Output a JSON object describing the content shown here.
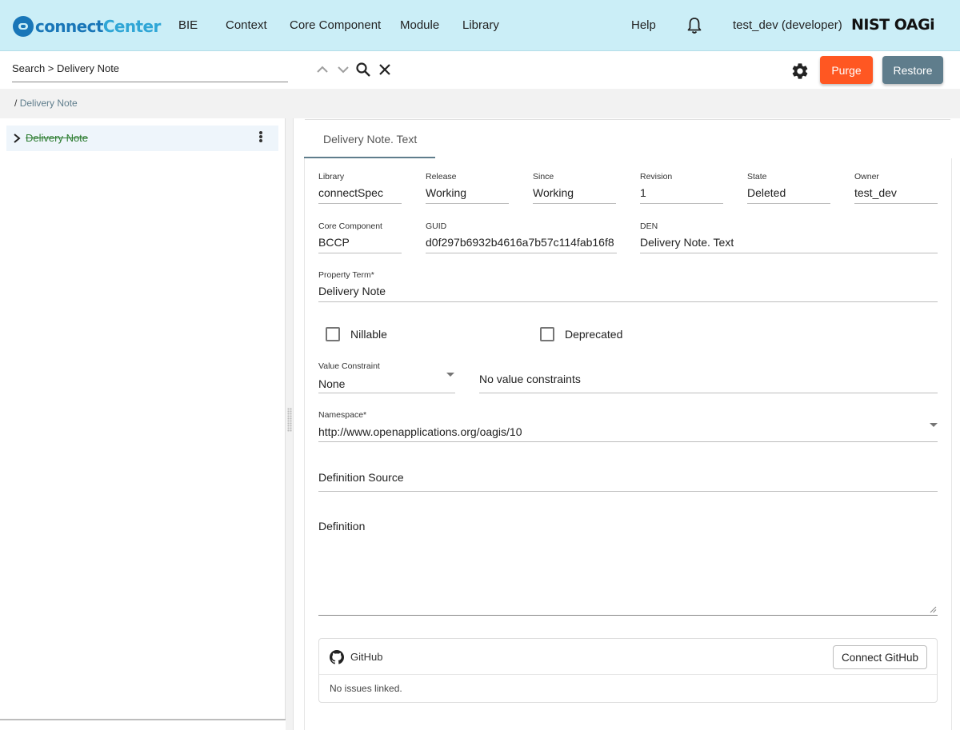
{
  "brand": {
    "part1": "connect",
    "part2": "Center"
  },
  "nav": {
    "items": [
      "BIE",
      "Context",
      "Core Component",
      "Module",
      "Library"
    ],
    "help": "Help",
    "user": "test_dev (developer)",
    "org_logo": "NIST OAGi"
  },
  "search": {
    "text": "Search > Delivery Note"
  },
  "actions": {
    "purge": "Purge",
    "restore": "Restore"
  },
  "breadcrumb": {
    "sep": "/",
    "current": "Delivery Note"
  },
  "tree": {
    "node_label": "Delivery Note"
  },
  "tab": {
    "label": "Delivery Note. Text"
  },
  "fields": {
    "library": {
      "label": "Library",
      "value": "connectSpec"
    },
    "release": {
      "label": "Release",
      "value": "Working"
    },
    "since": {
      "label": "Since",
      "value": "Working"
    },
    "revision": {
      "label": "Revision",
      "value": "1"
    },
    "state": {
      "label": "State",
      "value": "Deleted"
    },
    "owner": {
      "label": "Owner",
      "value": "test_dev"
    },
    "core_component": {
      "label": "Core Component",
      "value": "BCCP"
    },
    "guid": {
      "label": "GUID",
      "value": "d0f297b6932b4616a7b57c114fab16f8"
    },
    "den": {
      "label": "DEN",
      "value": "Delivery Note. Text"
    },
    "property_term": {
      "label": "Property Term*",
      "value": "Delivery Note"
    },
    "value_constraint": {
      "label": "Value Constraint",
      "value": "None",
      "note": "No value constraints"
    },
    "namespace": {
      "label": "Namespace*",
      "value": "http://www.openapplications.org/oagis/10"
    },
    "definition_source": {
      "label": "Definition Source"
    },
    "definition": {
      "label": "Definition"
    }
  },
  "checkboxes": {
    "nillable": "Nillable",
    "deprecated": "Deprecated"
  },
  "github": {
    "title": "GitHub",
    "button": "Connect GitHub",
    "empty": "No issues linked."
  },
  "colors": {
    "topbar": "#cbeef7",
    "purge": "#ff5722",
    "restore": "#5f7d8c",
    "deleted_label": "#2e7d32"
  },
  "icons": [
    "logo-icon",
    "bell-icon",
    "chevron-up-icon",
    "chevron-down-icon",
    "search-icon",
    "close-icon",
    "gear-icon",
    "chevron-right-icon",
    "more-vert-icon",
    "dropdown-caret-icon",
    "github-icon",
    "resize-handle-icon"
  ]
}
